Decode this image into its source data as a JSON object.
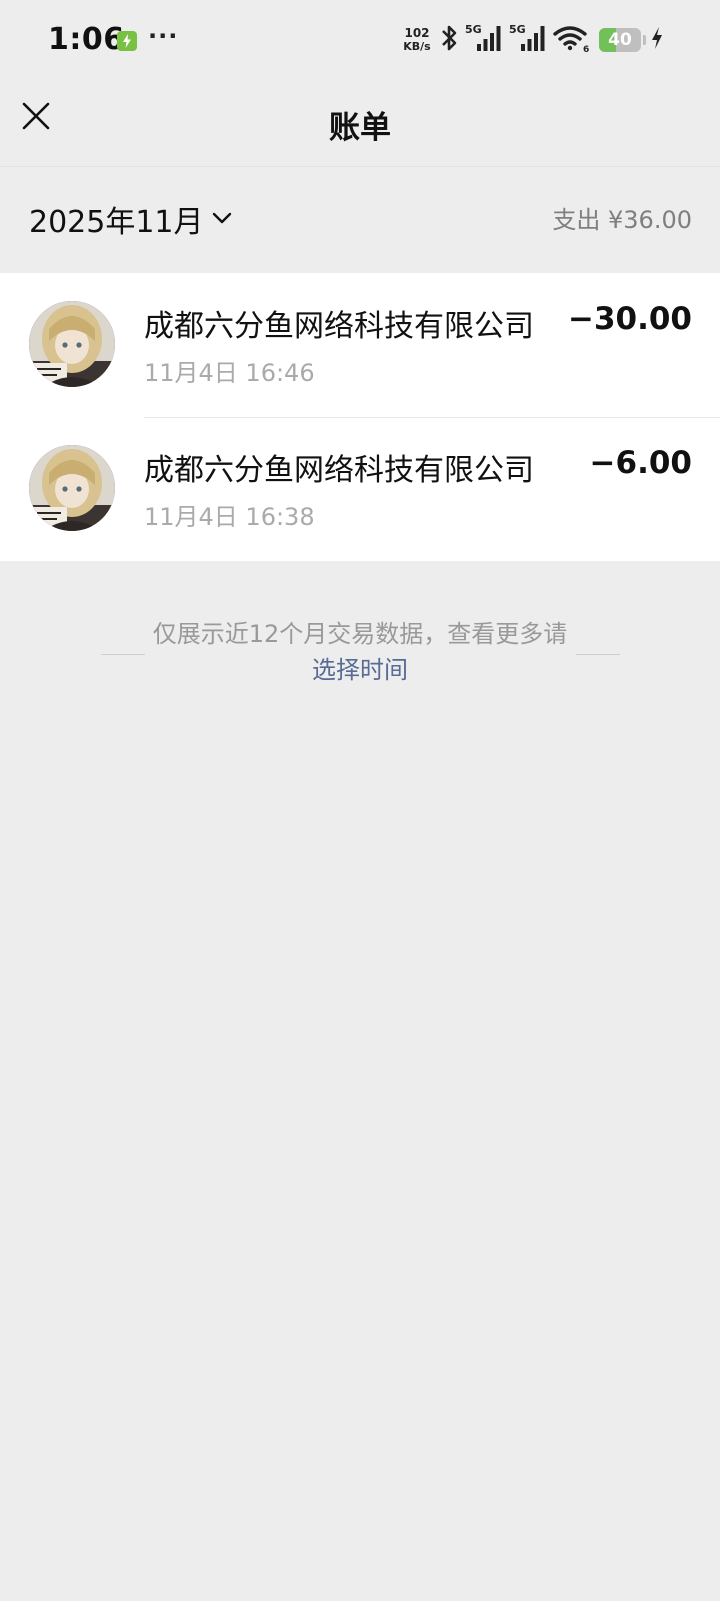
{
  "status_bar": {
    "time": "1:06",
    "more": "···",
    "net_speed": "102",
    "net_speed_unit": "KB/s",
    "signal_1": "5G",
    "signal_2": "5G",
    "wifi_badge": "6",
    "battery_level": "40",
    "battery_fraction": 0.4,
    "icons": [
      "app-notification-icon",
      "bluetooth-icon",
      "signal-5g-icon",
      "signal-5g-icon",
      "wifi-icon",
      "battery-icon",
      "charging-icon"
    ]
  },
  "header": {
    "title": "账单",
    "close_icon": "close-icon"
  },
  "filter": {
    "month": "2025年11月",
    "expense_summary": "支出 ¥36.00"
  },
  "transactions": [
    {
      "merchant": "成都六分鱼网络科技有限公司",
      "time": "11月4日 16:46",
      "amount": "−30.00"
    },
    {
      "merchant": "成都六分鱼网络科技有限公司",
      "time": "11月4日 16:38",
      "amount": "−6.00"
    }
  ],
  "footer": {
    "note": "仅展示近12个月交易数据，查看更多请",
    "link": "选择时间"
  },
  "colors": {
    "background": "#ededed",
    "card": "#ffffff",
    "link": "#576b95",
    "battery_fill": "#72c05a"
  }
}
